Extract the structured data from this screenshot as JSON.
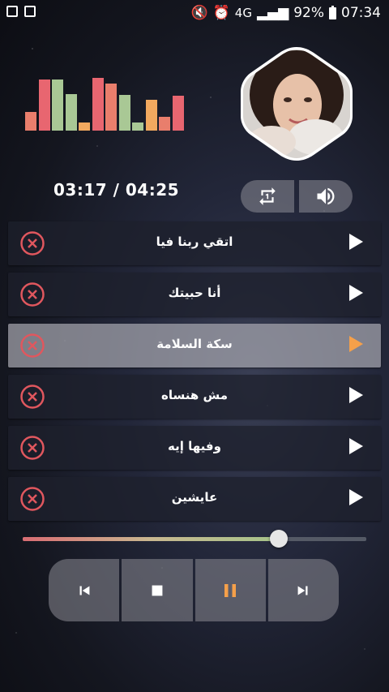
{
  "status_bar": {
    "network": "4G",
    "battery_percent": "92%",
    "time": "07:34"
  },
  "equalizer": {
    "levels": [
      0.35,
      0.95,
      0.95,
      0.68,
      0.15,
      0.98,
      0.88,
      0.66,
      0.15,
      0.58,
      0.25,
      0.65
    ],
    "colors": [
      "#e97e6c",
      "#e86670",
      "#a9c895",
      "#a9c895",
      "#f2a95f",
      "#e86670",
      "#e97e6c",
      "#a9c895",
      "#a9c895",
      "#f2a95f",
      "#e97e6c",
      "#e86670"
    ]
  },
  "player": {
    "time_display": "03:17 / 04:25",
    "progress": 0.745
  },
  "playlist": [
    {
      "title": "اتقي ربنا فيا",
      "active": false
    },
    {
      "title": "أنا حبيتك",
      "active": false
    },
    {
      "title": "سكة السلامة",
      "active": true
    },
    {
      "title": "مش هنساه",
      "active": false
    },
    {
      "title": "وفيها إيه",
      "active": false
    },
    {
      "title": "عايشين",
      "active": false
    }
  ],
  "colors": {
    "accent": "#f5a04a",
    "delete": "#e0575e"
  },
  "icons": {
    "repeat": "repeat-one-icon",
    "volume": "volume-icon",
    "prev": "skip-previous-icon",
    "stop": "stop-icon",
    "pause": "pause-icon",
    "next": "skip-next-icon"
  }
}
